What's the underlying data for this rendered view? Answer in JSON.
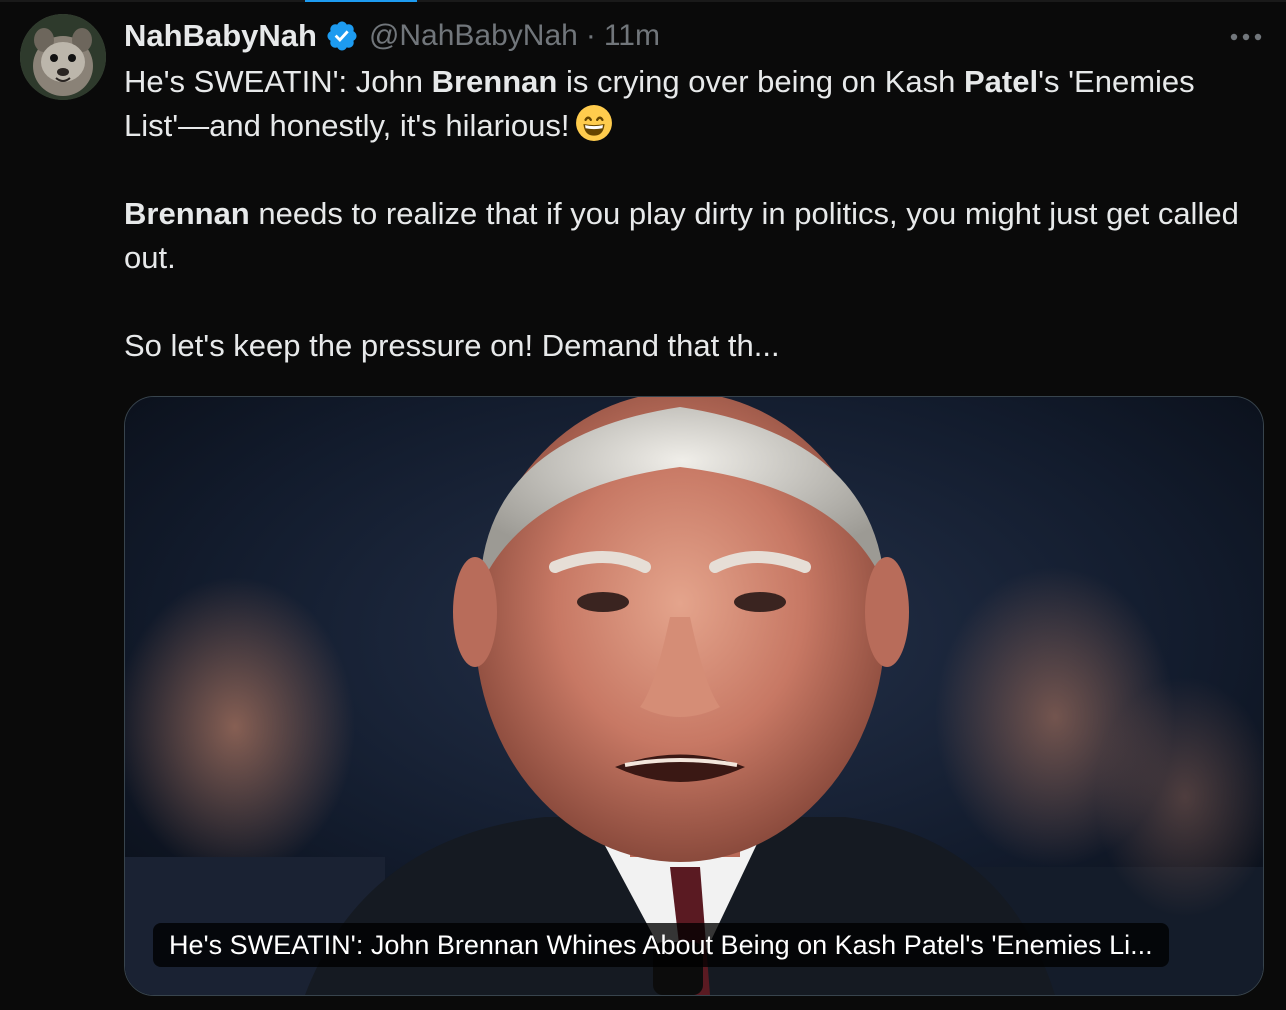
{
  "tweet": {
    "display_name": "NahBabyNah",
    "handle": "@NahBabyNah",
    "separator": "·",
    "time": "11m",
    "more_label": "···",
    "body": {
      "p1_a": "He's SWEATIN': John ",
      "p1_b": "Brennan",
      "p1_c": " is crying over being on Kash ",
      "p1_d": "Patel",
      "p1_e": "'s 'Enemies List'—and honestly, it's hilarious!",
      "p2_a": "Brennan",
      "p2_b": " needs to realize that if you play dirty in politics, you might just get called out.",
      "p3": "So let's keep the pressure on! Demand that th..."
    },
    "card": {
      "caption": "He's SWEATIN': John Brennan Whines About Being on Kash Patel's 'Enemies Li..."
    }
  },
  "icons": {
    "verified": "verified-badge-icon",
    "more": "more-options-icon",
    "emoji": "grinning-face-emoji-icon"
  },
  "colors": {
    "background": "#0a0a0a",
    "text": "#e7e9ea",
    "muted": "#71767b",
    "accent": "#1d9bf0",
    "card_border": "#38444d"
  }
}
